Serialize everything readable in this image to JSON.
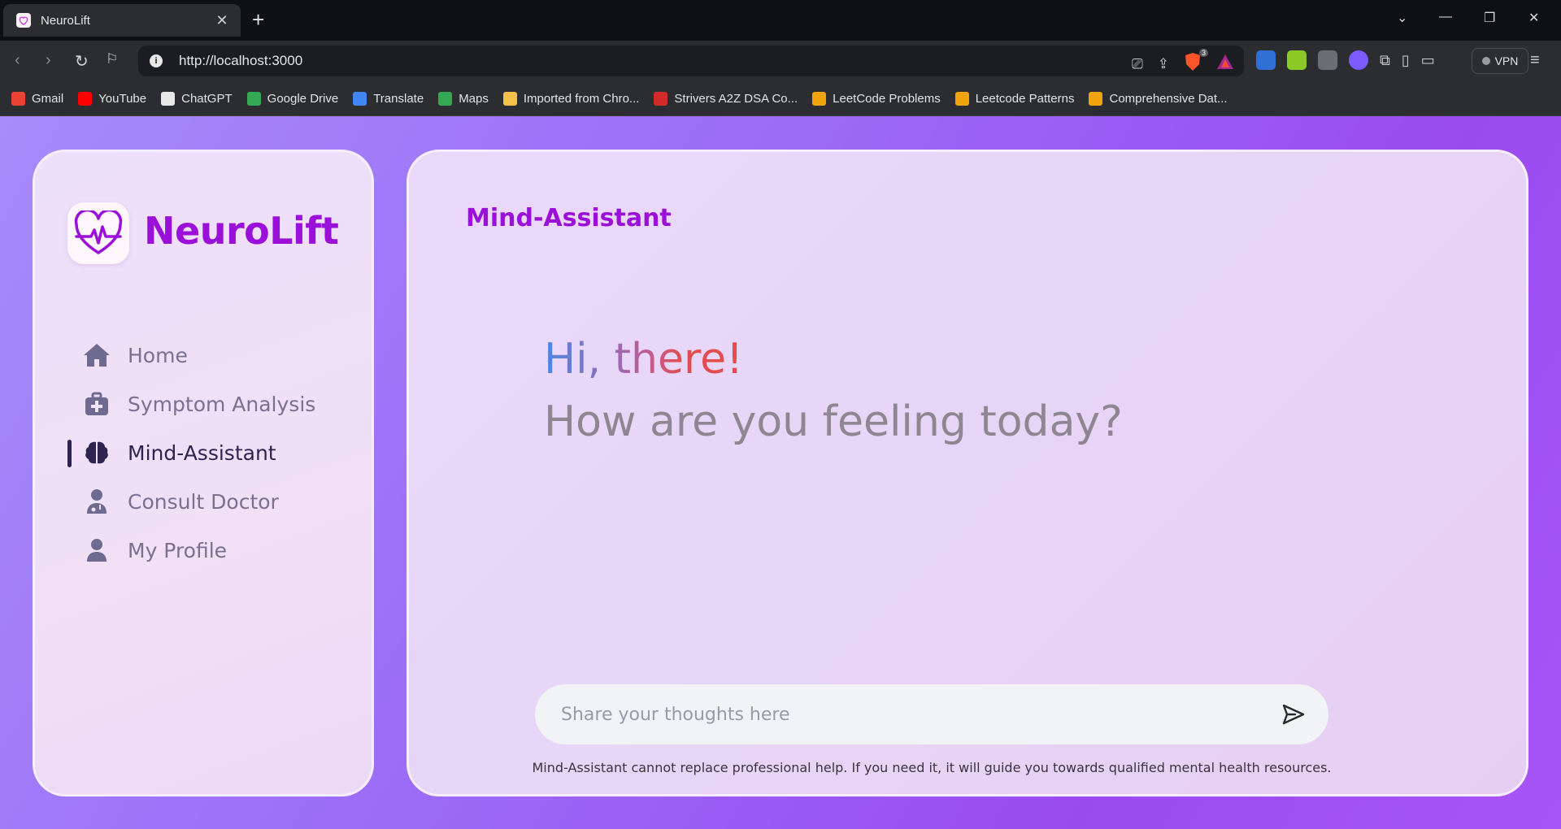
{
  "browser": {
    "tab_title": "NeuroLift",
    "tab_close": "✕",
    "new_tab": "+",
    "url": "http://localhost:3000",
    "vpn_label": "VPN",
    "brave_badge": "3",
    "bookmarks": [
      {
        "label": "Gmail",
        "icon": "gmail-icon",
        "color": "#ea4335"
      },
      {
        "label": "YouTube",
        "icon": "youtube-icon",
        "color": "#ff0000"
      },
      {
        "label": "ChatGPT",
        "icon": "chatgpt-icon",
        "color": "#e8e8e8"
      },
      {
        "label": "Google Drive",
        "icon": "drive-icon",
        "color": "#34a853"
      },
      {
        "label": "Translate",
        "icon": "translate-icon",
        "color": "#4285f4"
      },
      {
        "label": "Maps",
        "icon": "maps-icon",
        "color": "#34a853"
      },
      {
        "label": "Imported from Chro...",
        "icon": "folder-icon",
        "color": "#f4c04b"
      },
      {
        "label": "Strivers A2Z DSA Co...",
        "icon": "tuf-icon",
        "color": "#d12b2b"
      },
      {
        "label": "LeetCode Problems",
        "icon": "leetcode-icon",
        "color": "#f0a30a"
      },
      {
        "label": "Leetcode Patterns",
        "icon": "leetcode-icon",
        "color": "#f0a30a"
      },
      {
        "label": "Comprehensive Dat...",
        "icon": "leetcode-icon",
        "color": "#f0a30a"
      }
    ]
  },
  "app": {
    "brand": "NeuroLift",
    "accent": "#9b10d8",
    "nav": [
      {
        "label": "Home",
        "icon": "home-icon"
      },
      {
        "label": "Symptom Analysis",
        "icon": "medkit-icon"
      },
      {
        "label": "Mind-Assistant",
        "icon": "brain-icon",
        "active": true
      },
      {
        "label": "Consult Doctor",
        "icon": "doctor-icon"
      },
      {
        "label": "My Profile",
        "icon": "user-icon"
      }
    ],
    "main": {
      "title": "Mind-Assistant",
      "greeting": "Hi, there!",
      "question": "How are you feeling today?",
      "input_placeholder": "Share your thoughts here",
      "disclaimer": "Mind-Assistant cannot replace professional help. If you need it, it will guide you towards qualified mental health resources."
    }
  }
}
